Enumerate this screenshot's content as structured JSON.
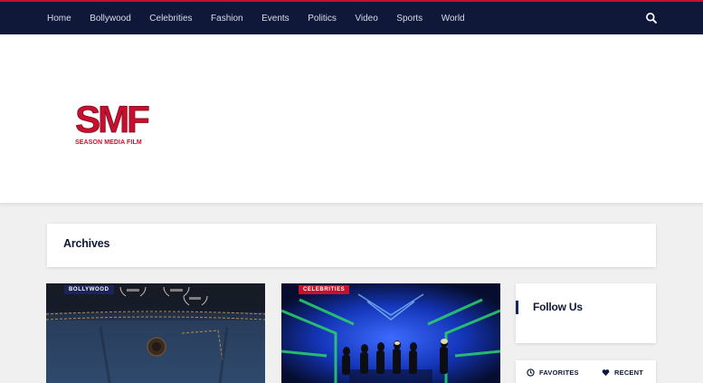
{
  "nav": {
    "items": [
      "Home",
      "Bollywood",
      "Celebrities",
      "Fashion",
      "Events",
      "Politics",
      "Video",
      "Sports",
      "World"
    ]
  },
  "logo": {
    "mark": "SMF",
    "text": "SEASON MEDIA FILM"
  },
  "archives": {
    "title": "Archives"
  },
  "cards": [
    {
      "category": "BOLLYWOOD"
    },
    {
      "category": "CELEBRITIES"
    }
  ],
  "sidebar": {
    "follow_title": "Follow Us",
    "tabs": [
      {
        "label": "FAVORITES",
        "icon": "clock-icon"
      },
      {
        "label": "RECENT",
        "icon": "heart-icon"
      }
    ]
  },
  "colors": {
    "nav_bg": "#0f1838",
    "accent": "#c8102e",
    "badge_blue": "#1a2458"
  }
}
